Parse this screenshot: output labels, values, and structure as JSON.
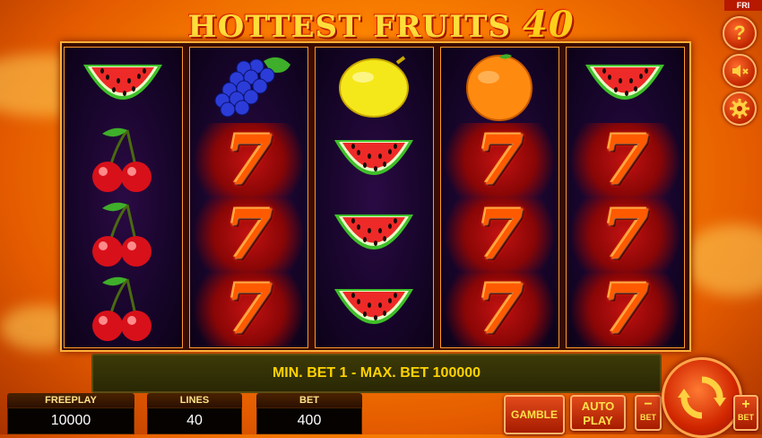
{
  "title": {
    "text": "HOTTEST FRUITS",
    "number": "40"
  },
  "corner_tab": "FRI",
  "side_buttons": {
    "help": "?",
    "sound": "🔈",
    "settings": "⚙"
  },
  "reels": [
    [
      "watermelon",
      "cherry",
      "cherry",
      "cherry"
    ],
    [
      "grapes",
      "seven",
      "seven",
      "seven"
    ],
    [
      "lemon",
      "watermelon",
      "watermelon",
      "watermelon"
    ],
    [
      "orange",
      "seven",
      "seven",
      "seven"
    ],
    [
      "watermelon",
      "seven",
      "seven",
      "seven"
    ]
  ],
  "seven_glyph": "7",
  "bet_message": "MIN. BET 1 - MAX. BET 100000",
  "freeplay": {
    "label": "FREEPLAY",
    "value": "10000"
  },
  "lines": {
    "label": "LINES",
    "value": "40"
  },
  "bet": {
    "label": "BET",
    "value": "400"
  },
  "buttons": {
    "gamble": "GAMBLE",
    "autoplay_line1": "AUTO",
    "autoplay_line2": "PLAY",
    "minus_symbol": "−",
    "minus_label": "BET",
    "plus_symbol": "+",
    "plus_label": "BET"
  }
}
